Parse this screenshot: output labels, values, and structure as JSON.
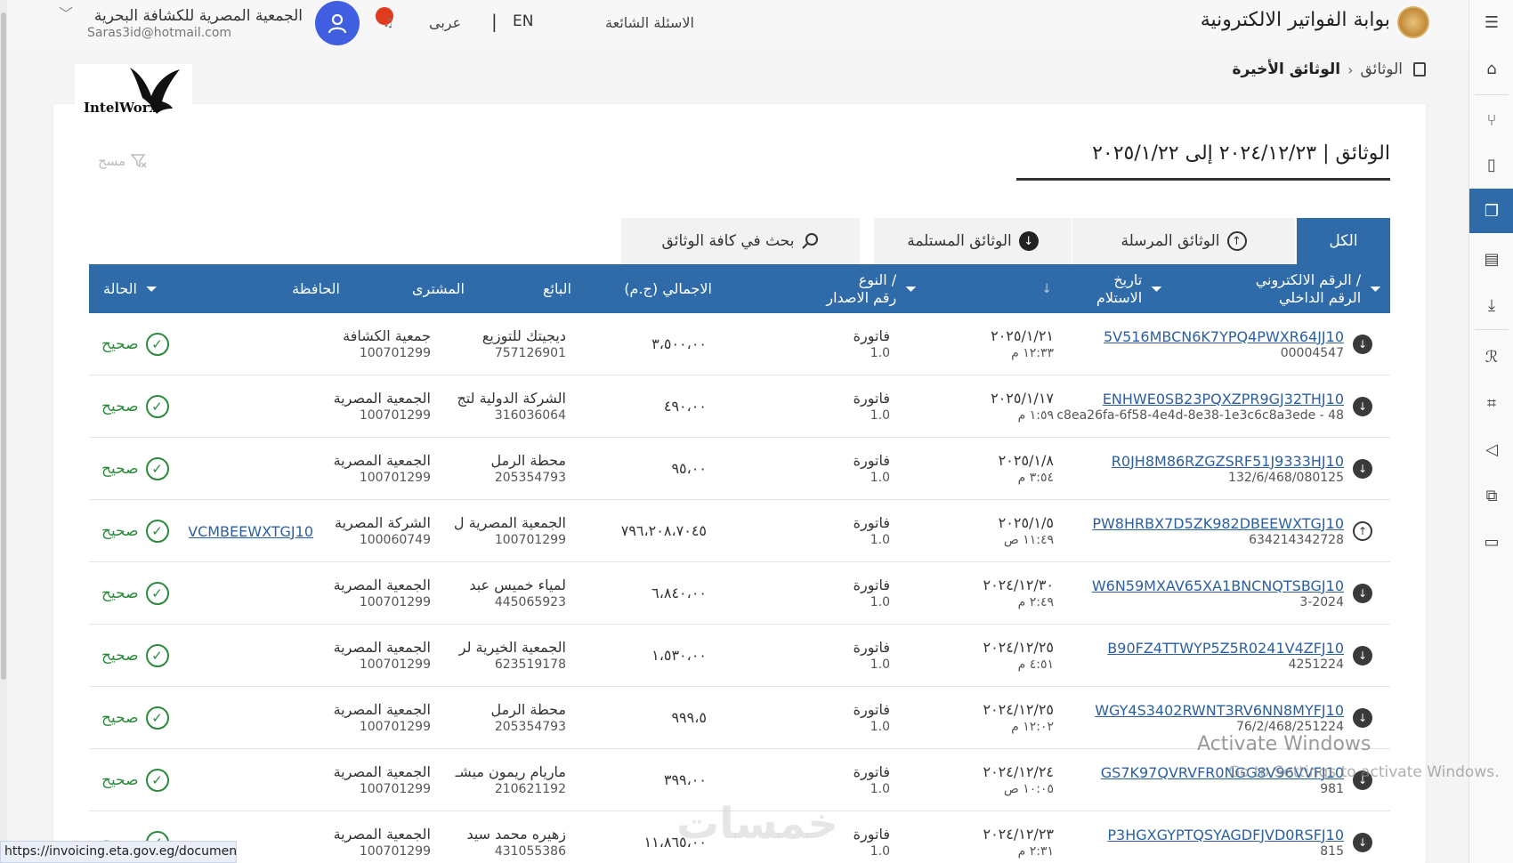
{
  "header": {
    "portal_title": "بوابة الفواتير الالكترونية",
    "faq": "الاسئلة الشائعة",
    "lang_en": "EN",
    "lang_sep": "|",
    "lang_ar": "عربى",
    "user_name": "الجمعية المصرية للكشافة البحرية",
    "user_email": "Saras3id@hotmail.com"
  },
  "breadcrumb": {
    "root": "الوثائق",
    "sep": "›",
    "current": "الوثائق الأخيرة"
  },
  "logo": {
    "text": "IntelWorx"
  },
  "page": {
    "title": "الوثائق | ٢٠٢٤/١٢/٢٣ إلى ٢٠٢٥/١/٢٢",
    "clear_filter": "مسح"
  },
  "tabs": {
    "all": "الكل",
    "sent": "الوثائق المرسلة",
    "received": "الوثائق المستلمة",
    "search": "بحث في كافة الوثائق"
  },
  "columns": {
    "uuid_l1": "الرقم الالكتروني /",
    "uuid_l2": "الرقم الداخلي",
    "date_l1": "تاريخ",
    "date_l2": "الاستلام",
    "type_l1": "النوع /",
    "type_l2": "رقم الاصدار",
    "total": "الاجمالي (ج.م)",
    "seller": "البائع",
    "buyer": "المشترى",
    "wallet": "الحافظة",
    "status": "الحالة"
  },
  "rows": [
    {
      "dir": "in",
      "uuid": "5V516MBCN6K7YPQ4PWXR64JJ10",
      "internal": "00004547",
      "date": "٢٠٢٥/١/٢١",
      "time": "١٢:٣٣ م",
      "type": "فاتورة",
      "version": "1.0",
      "total": "٣،٥٠٠،٠٠",
      "seller": "ديجيتك للتوزيع",
      "seller_id": "757126901",
      "buyer": "جمعية الكشافة",
      "buyer_id": "100701299",
      "wallet": "",
      "status": "صحيح"
    },
    {
      "dir": "in",
      "uuid": "ENHWE0SB23PQXZPR9GJ32THJ10",
      "internal": "c8ea26fa-6f58-4e4d-8e38-1e3c6c8a3ede - 48",
      "date": "٢٠٢٥/١/١٧",
      "time": "١:٥٩ م",
      "type": "فاتورة",
      "version": "1.0",
      "total": "٤٩٠،٠٠",
      "seller": "الشركة الدولية لتج",
      "seller_id": "316036064",
      "buyer": "الجمعية المصرية",
      "buyer_id": "100701299",
      "wallet": "",
      "status": "صحيح"
    },
    {
      "dir": "in",
      "uuid": "R0JH8M86RZGZSRF51J9333HJ10",
      "internal": "132/6/468/080125",
      "date": "٢٠٢٥/١/٨",
      "time": "٣:٥٤ م",
      "type": "فاتورة",
      "version": "1.0",
      "total": "٩٥،٠٠",
      "seller": "محطة الرمل",
      "seller_id": "205354793",
      "buyer": "الجمعية المصرية",
      "buyer_id": "100701299",
      "wallet": "",
      "status": "صحيح"
    },
    {
      "dir": "out",
      "uuid": "PW8HRBX7D5ZK982DBEEWXTGJ10",
      "internal": "634214342728",
      "date": "٢٠٢٥/١/٥",
      "time": "١١:٤٩ ص",
      "type": "فاتورة",
      "version": "1.0",
      "total": "٧٩٦،٢٠٨،٧٠٤٥",
      "seller": "الجمعية المصرية ل",
      "seller_id": "100701299",
      "buyer": "الشركة المصرية",
      "buyer_id": "100060749",
      "wallet": "VCMBEEWXTGJ10",
      "status": "صحيح"
    },
    {
      "dir": "in",
      "uuid": "W6N59MXAV65XA1BNCNQTSBGJ10",
      "internal": "3-2024",
      "date": "٢٠٢٤/١٢/٣٠",
      "time": "٢:٤٩ م",
      "type": "فاتورة",
      "version": "1.0",
      "total": "٦،٨٤٠،٠٠",
      "seller": "لمياء خميس عبد",
      "seller_id": "445065923",
      "buyer": "الجمعية المصرية",
      "buyer_id": "100701299",
      "wallet": "",
      "status": "صحيح"
    },
    {
      "dir": "in",
      "uuid": "B90FZ4TTWYP5Z5R0241V4ZFJ10",
      "internal": "4251224",
      "date": "٢٠٢٤/١٢/٢٥",
      "time": "٤:٥١ م",
      "type": "فاتورة",
      "version": "1.0",
      "total": "١،٥٣٠،٠٠",
      "seller": "الجمعية الخيرية لر",
      "seller_id": "623519178",
      "buyer": "الجمعية المصرية",
      "buyer_id": "100701299",
      "wallet": "",
      "status": "صحيح"
    },
    {
      "dir": "in",
      "uuid": "WGY4S3402RWNT3RV6NN8MYFJ10",
      "internal": "76/2/468/251224",
      "date": "٢٠٢٤/١٢/٢٥",
      "time": "١٢:٠٢ م",
      "type": "فاتورة",
      "version": "1.0",
      "total": "٩٩٩،٥",
      "seller": "محطة الرمل",
      "seller_id": "205354793",
      "buyer": "الجمعية المصرية",
      "buyer_id": "100701299",
      "wallet": "",
      "status": "صحيح"
    },
    {
      "dir": "in",
      "uuid": "GS7K97QVRVFR0NGG8V96VVFJ10",
      "internal": "981",
      "date": "٢٠٢٤/١٢/٢٤",
      "time": "١٠:٠٥ ص",
      "type": "فاتورة",
      "version": "1.0",
      "total": "٣٩٩،٠٠",
      "seller": "ماريام ريمون ميشـ",
      "seller_id": "210621192",
      "buyer": "الجمعية المصرية",
      "buyer_id": "100701299",
      "wallet": "",
      "status": "صحيح"
    },
    {
      "dir": "in",
      "uuid": "P3HGXGYPTQSYAGDFJVD0RSFJ10",
      "internal": "815",
      "date": "٢٠٢٤/١٢/٢٣",
      "time": "٢:٣١ م",
      "type": "فاتورة",
      "version": "1.0",
      "total": "١١،٨٦٥،٠٠",
      "seller": "زهيره محمد سيد",
      "seller_id": "431055386",
      "buyer": "الجمعية المصرية",
      "buyer_id": "100701299",
      "wallet": "",
      "status": "صحيح"
    }
  ],
  "overlay": {
    "activate_title": "Activate Windows",
    "activate_sub": "Go to Settings to activate Windows.",
    "status_url": "https://invoicing.eta.gov.eg/documents",
    "watermark": "خمسات"
  }
}
